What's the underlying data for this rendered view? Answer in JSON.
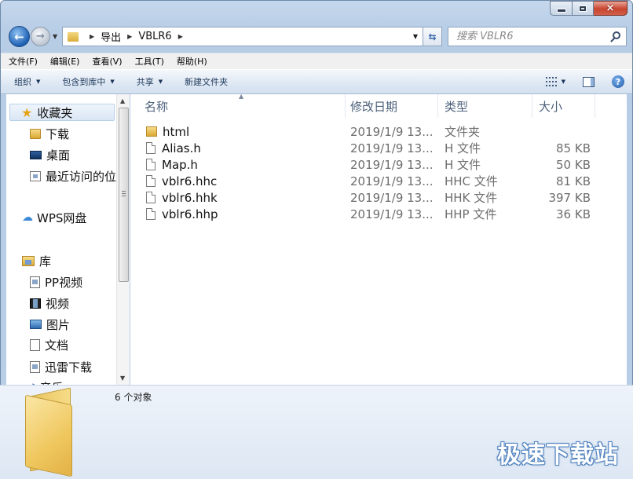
{
  "window": {
    "caption": {
      "close_glyph": "×"
    }
  },
  "nav": {
    "back_glyph": "←",
    "forward_glyph": "→",
    "breadcrumb": [
      "导出",
      "VBLR6"
    ],
    "refresh_glyph": "⇆",
    "search_placeholder": "搜索 VBLR6"
  },
  "menu": [
    "文件(F)",
    "编辑(E)",
    "查看(V)",
    "工具(T)",
    "帮助(H)"
  ],
  "toolbar": {
    "organize": "组织",
    "include_library": "包含到库中",
    "share": "共享",
    "new_folder": "新建文件夹",
    "help_glyph": "?"
  },
  "sidebar": {
    "favorites": "收藏夹",
    "fav_items": [
      "下载",
      "桌面",
      "最近访问的位"
    ],
    "wps": "WPS网盘",
    "library": "库",
    "lib_items": [
      "PP视频",
      "视频",
      "图片",
      "文档",
      "迅雷下载",
      "音乐"
    ]
  },
  "columns": {
    "name": "名称",
    "date": "修改日期",
    "type": "类型",
    "size": "大小"
  },
  "files": [
    {
      "name": "html",
      "date": "2019/1/9 13...",
      "type": "文件夹",
      "size": "",
      "icon": "folder-icon"
    },
    {
      "name": "Alias.h",
      "date": "2019/1/9 13...",
      "type": "H 文件",
      "size": "85 KB",
      "icon": "document-icon"
    },
    {
      "name": "Map.h",
      "date": "2019/1/9 13...",
      "type": "H 文件",
      "size": "50 KB",
      "icon": "document-icon"
    },
    {
      "name": "vblr6.hhc",
      "date": "2019/1/9 13...",
      "type": "HHC 文件",
      "size": "81 KB",
      "icon": "document-icon"
    },
    {
      "name": "vblr6.hhk",
      "date": "2019/1/9 13...",
      "type": "HHK 文件",
      "size": "397 KB",
      "icon": "document-icon"
    },
    {
      "name": "vblr6.hhp",
      "date": "2019/1/9 13...",
      "type": "HHP 文件",
      "size": "36 KB",
      "icon": "document-icon"
    }
  ],
  "details": {
    "object_count": "6 个对象"
  },
  "watermark": "极速下载站"
}
